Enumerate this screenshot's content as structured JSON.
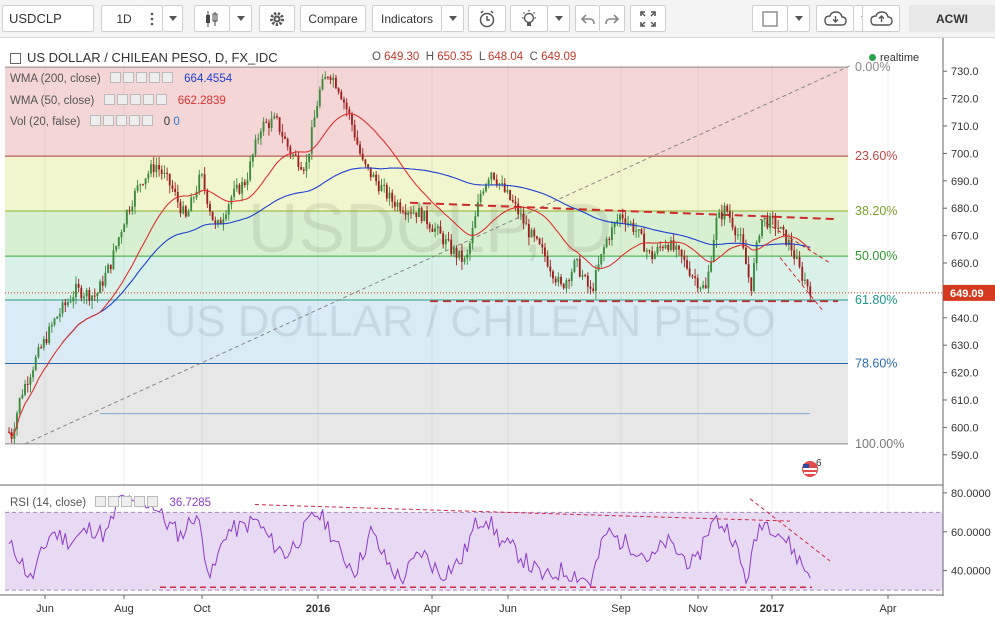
{
  "toolbar": {
    "symbol": "USDCLP",
    "interval": "1D",
    "compare_label": "Compare",
    "indicators_label": "Indicators",
    "watchlist_label": "ACWI"
  },
  "colors": {
    "up_candle": "#3b8a3e",
    "down_candle": "#a02020",
    "wma200": "#1f3fd0",
    "wma50": "#e03030",
    "rsi_line": "#8a3cc8",
    "price_badge": "#d43b1e"
  },
  "main": {
    "title": "US DOLLAR / CHILEAN PESO, D, FX_IDC",
    "watermark_symbol": "USDCLP, D",
    "watermark_name": "US DOLLAR / CHILEAN PESO",
    "ohlc": {
      "o_label": "O",
      "o": "649.30",
      "h_label": "H",
      "h": "650.35",
      "l_label": "L",
      "l": "648.04",
      "c_label": "C",
      "c": "649.09"
    },
    "realtime_label": "realtime",
    "last_price": "649.09",
    "indicators": [
      {
        "label": "WMA (200, close)",
        "value": "664.4554",
        "color": "#1f3fd0"
      },
      {
        "label": "WMA (50, close)",
        "value": "662.2839",
        "color": "#e03030"
      },
      {
        "label": "Vol (20, false)",
        "value": "0",
        "value2": "0",
        "color": "#333"
      }
    ],
    "alert_badge": "6"
  },
  "rsi": {
    "label": "RSI (14, close)",
    "value": "36.7285"
  },
  "chart_data": {
    "type": "candlestick",
    "price_axis": {
      "ticks": [
        590,
        600,
        610,
        620,
        630,
        640,
        650,
        660,
        670,
        680,
        690,
        700,
        710,
        720,
        730
      ],
      "range": [
        587,
        733
      ]
    },
    "rsi_axis": {
      "ticks": [
        "40.0000",
        "60.0000",
        "80.0000"
      ],
      "range": [
        28,
        82
      ],
      "bands": [
        30,
        70
      ]
    },
    "time_axis": [
      "Jun",
      "Aug",
      "Oct",
      "2016",
      "Apr",
      "Jun",
      "Sep",
      "Nov",
      "2017",
      "Apr"
    ],
    "fibonacci": [
      {
        "level": "0.00%",
        "price": 731.5
      },
      {
        "level": "23.60%",
        "price": 699.0
      },
      {
        "level": "38.20%",
        "price": 679.0
      },
      {
        "level": "50.00%",
        "price": 662.5
      },
      {
        "level": "61.80%",
        "price": 646.5
      },
      {
        "level": "78.60%",
        "price": 623.3
      },
      {
        "level": "100.00%",
        "price": 594.0
      }
    ],
    "price_keypoints": [
      [
        0,
        608
      ],
      [
        10,
        596
      ],
      [
        20,
        612
      ],
      [
        35,
        625
      ],
      [
        55,
        640
      ],
      [
        75,
        650
      ],
      [
        95,
        648
      ],
      [
        110,
        660
      ],
      [
        125,
        678
      ],
      [
        140,
        690
      ],
      [
        155,
        696
      ],
      [
        170,
        688
      ],
      [
        185,
        676
      ],
      [
        200,
        692
      ],
      [
        215,
        672
      ],
      [
        230,
        684
      ],
      [
        245,
        690
      ],
      [
        260,
        710
      ],
      [
        275,
        712
      ],
      [
        290,
        700
      ],
      [
        305,
        695
      ],
      [
        318,
        722
      ],
      [
        328,
        730
      ],
      [
        338,
        724
      ],
      [
        350,
        712
      ],
      [
        362,
        696
      ],
      [
        375,
        690
      ],
      [
        390,
        683
      ],
      [
        405,
        680
      ],
      [
        420,
        678
      ],
      [
        435,
        672
      ],
      [
        450,
        665
      ],
      [
        465,
        660
      ],
      [
        480,
        686
      ],
      [
        490,
        694
      ],
      [
        500,
        688
      ],
      [
        515,
        680
      ],
      [
        530,
        670
      ],
      [
        545,
        662
      ],
      [
        560,
        651
      ],
      [
        575,
        660
      ],
      [
        590,
        649
      ],
      [
        605,
        668
      ],
      [
        620,
        678
      ],
      [
        635,
        672
      ],
      [
        650,
        662
      ],
      [
        665,
        668
      ],
      [
        680,
        662
      ],
      [
        695,
        654
      ],
      [
        705,
        650
      ],
      [
        715,
        675
      ],
      [
        725,
        680
      ],
      [
        740,
        668
      ],
      [
        750,
        651
      ],
      [
        760,
        676
      ],
      [
        775,
        674
      ],
      [
        790,
        666
      ],
      [
        800,
        656
      ],
      [
        812,
        649
      ]
    ],
    "rsi_keypoints": [
      [
        0,
        55
      ],
      [
        15,
        50
      ],
      [
        30,
        35
      ],
      [
        50,
        60
      ],
      [
        70,
        55
      ],
      [
        90,
        62
      ],
      [
        105,
        58
      ],
      [
        120,
        78
      ],
      [
        135,
        72
      ],
      [
        150,
        76
      ],
      [
        165,
        65
      ],
      [
        180,
        58
      ],
      [
        195,
        70
      ],
      [
        210,
        36
      ],
      [
        225,
        60
      ],
      [
        240,
        62
      ],
      [
        255,
        66
      ],
      [
        270,
        55
      ],
      [
        285,
        48
      ],
      [
        300,
        58
      ],
      [
        315,
        70
      ],
      [
        325,
        65
      ],
      [
        340,
        48
      ],
      [
        355,
        40
      ],
      [
        370,
        60
      ],
      [
        385,
        45
      ],
      [
        400,
        35
      ],
      [
        420,
        50
      ],
      [
        440,
        38
      ],
      [
        460,
        45
      ],
      [
        475,
        64
      ],
      [
        485,
        68
      ],
      [
        500,
        55
      ],
      [
        515,
        50
      ],
      [
        530,
        42
      ],
      [
        545,
        36
      ],
      [
        560,
        40
      ],
      [
        575,
        38
      ],
      [
        590,
        34
      ],
      [
        605,
        60
      ],
      [
        620,
        55
      ],
      [
        635,
        52
      ],
      [
        650,
        45
      ],
      [
        665,
        55
      ],
      [
        680,
        48
      ],
      [
        695,
        42
      ],
      [
        705,
        60
      ],
      [
        715,
        66
      ],
      [
        730,
        60
      ],
      [
        745,
        35
      ],
      [
        760,
        66
      ],
      [
        775,
        62
      ],
      [
        790,
        52
      ],
      [
        805,
        40
      ],
      [
        812,
        37
      ]
    ]
  }
}
